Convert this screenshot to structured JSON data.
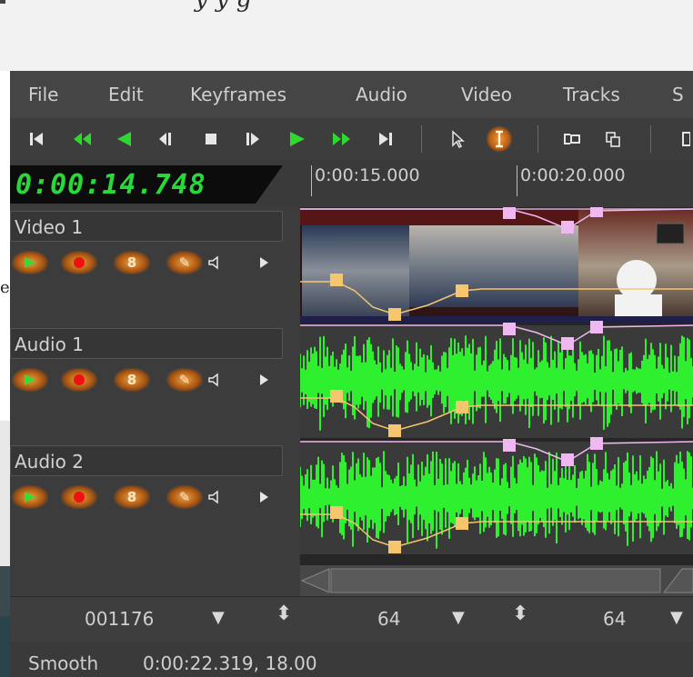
{
  "backdrop": {
    "partial_text": "y                       y       g"
  },
  "menu": [
    "File",
    "Edit",
    "Keyframes",
    "Audio",
    "Video",
    "Tracks",
    "S"
  ],
  "toolbar": {
    "buttons": [
      {
        "name": "goto-start-icon",
        "glyph": "⏮",
        "color": "white"
      },
      {
        "name": "fast-rewind-icon",
        "glyph": "«",
        "color": "green"
      },
      {
        "name": "rewind-icon",
        "glyph": "◀",
        "color": "green"
      },
      {
        "name": "frame-back-icon",
        "glyph": "◀|",
        "color": "white"
      },
      {
        "name": "stop-icon",
        "glyph": "■",
        "color": "white"
      },
      {
        "name": "frame-forward-icon",
        "glyph": "|▶",
        "color": "white"
      },
      {
        "name": "play-icon",
        "glyph": "▶",
        "color": "green"
      },
      {
        "name": "fast-forward-icon",
        "glyph": "»",
        "color": "green"
      },
      {
        "name": "goto-end-icon",
        "glyph": "⏭",
        "color": "white"
      },
      {
        "name": "arrow-select-icon",
        "glyph": "↖",
        "color": "white"
      },
      {
        "name": "ibeam-edit-icon",
        "glyph": "I",
        "color": "white"
      },
      {
        "name": "copy-icon",
        "glyph": "⧉",
        "color": "white"
      },
      {
        "name": "paste-icon",
        "glyph": "⎘",
        "color": "white"
      }
    ]
  },
  "clock": {
    "time": "0:00:14.748"
  },
  "ruler": {
    "labels": [
      "0:00:15.000",
      "0:00:20.000"
    ]
  },
  "tracks": [
    {
      "name": "Video 1",
      "type": "video"
    },
    {
      "name": "Audio 1",
      "type": "audio"
    },
    {
      "name": "Audio 2",
      "type": "audio"
    }
  ],
  "track_buttons": [
    {
      "name": "play-track-icon",
      "glyph": "▶",
      "color": "#33dd33"
    },
    {
      "name": "record-icon",
      "glyph": "●",
      "color": "#ee1111"
    },
    {
      "name": "gang-icon",
      "glyph": "8",
      "color": "#f0e0c0"
    },
    {
      "name": "draw-icon",
      "glyph": "✎",
      "color": "#f0e0c0"
    },
    {
      "name": "mute-speaker-icon",
      "glyph": "◁",
      "color": "#e0e0e0"
    },
    {
      "name": "expand-icon",
      "glyph": "▶",
      "color": "#e0e0e0"
    }
  ],
  "colors": {
    "waveform": "#2ff02f",
    "fade_keyframe": "#f6c66e",
    "pan_keyframe": "#f0b8f0",
    "clock_green": "#29d93a"
  },
  "bottombar": {
    "value1": "001176",
    "value2": "64",
    "value3": "64"
  },
  "status": {
    "mode": "Smooth",
    "info": "0:00:22.319, 18.00"
  }
}
